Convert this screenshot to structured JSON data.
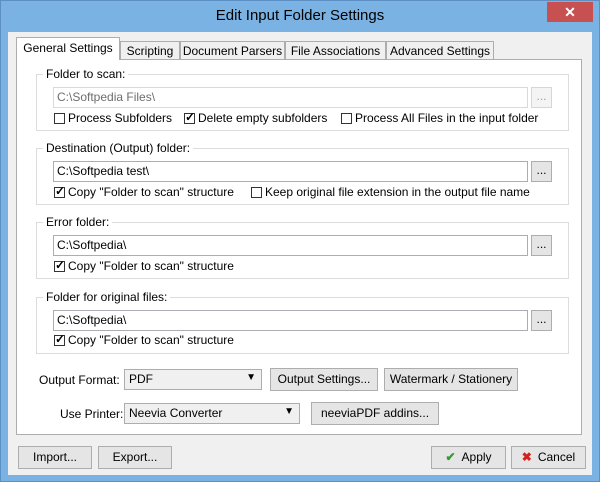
{
  "window": {
    "title": "Edit Input Folder Settings",
    "close_glyph": "✕"
  },
  "tabs": [
    {
      "label": "General Settings"
    },
    {
      "label": "Scripting"
    },
    {
      "label": "Document Parsers"
    },
    {
      "label": "File Associations"
    },
    {
      "label": "Advanced Settings"
    }
  ],
  "folder_to_scan": {
    "legend": "Folder to scan:",
    "path": "C:\\Softpedia Files\\",
    "browse": "...",
    "process_subfolders": "Process Subfolders",
    "delete_empty": "Delete empty subfolders",
    "process_all": "Process All Files in the input folder"
  },
  "destination": {
    "legend": "Destination (Output) folder:",
    "path": "C:\\Softpedia test\\",
    "browse": "...",
    "copy_structure": "Copy \"Folder to scan\" structure",
    "keep_ext": "Keep original file extension in the output file name"
  },
  "error_folder": {
    "legend": "Error folder:",
    "path": "C:\\Softpedia\\",
    "browse": "...",
    "copy_structure": "Copy \"Folder to scan\" structure"
  },
  "original_files": {
    "legend": "Folder for original files:",
    "path": "C:\\Softpedia\\",
    "browse": "...",
    "copy_structure": "Copy \"Folder to scan\" structure"
  },
  "output": {
    "format_label": "Output Format:",
    "format_value": "PDF",
    "settings_button": "Output Settings...",
    "watermark_button": "Watermark / Stationery",
    "printer_label": "Use Printer:",
    "printer_value": "Neevia Converter",
    "addins_button": "neeviaPDF addins..."
  },
  "footer": {
    "import": "Import...",
    "export": "Export...",
    "apply": "Apply",
    "cancel": "Cancel"
  }
}
